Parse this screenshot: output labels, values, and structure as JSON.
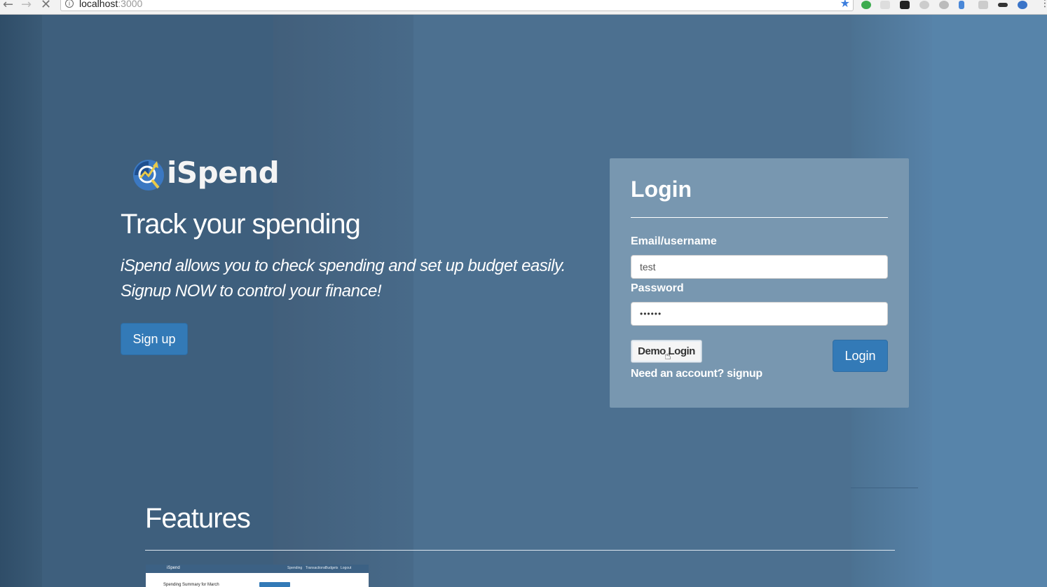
{
  "browser": {
    "url_host": "localhost",
    "url_port": ":3000"
  },
  "hero": {
    "logo_text": "iSpend",
    "title": "Track your spending",
    "subtitle_line1": "iSpend allows you to check spending and set up budget easily.",
    "subtitle_line2": "Signup NOW to control your finance!",
    "signup_label": "Sign up"
  },
  "login": {
    "heading": "Login",
    "email_label": "Email/username",
    "email_value": "test",
    "password_label": "Password",
    "password_value": "••••••",
    "demo_label": "Demo Login",
    "need_account": "Need an account? signup",
    "login_label": "Login"
  },
  "features": {
    "title": "Features",
    "thumbnail": {
      "logo": "iSpend",
      "nav": [
        "Spending",
        "Transactions",
        "Budgets",
        "Logout"
      ],
      "summary": "Spending Summary for March"
    }
  },
  "colors": {
    "primary_button": "#337ab7",
    "login_panel": "#7897b0"
  }
}
